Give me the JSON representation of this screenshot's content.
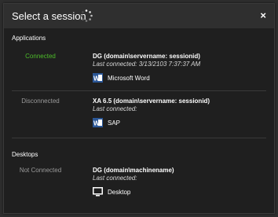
{
  "dialog": {
    "title": "Select a session",
    "close_label": "×"
  },
  "applications": {
    "header": "Applications",
    "sessions": [
      {
        "status": "Connected",
        "name": "DG (domain\\servername: sessionid)",
        "last_connected": "Last connected: 3/13/2103 7:37:37 AM",
        "app_label": "Microsoft Word",
        "app_icon": "word-icon"
      },
      {
        "status": "Disconnected",
        "name": "XA 6.5 (domain\\servername: sessionid)",
        "last_connected": "Last connected:",
        "app_label": "SAP",
        "app_icon": "word-icon"
      }
    ]
  },
  "desktops": {
    "header": "Desktops",
    "sessions": [
      {
        "status": "Not Connected",
        "name": "DG (domain\\machinename)",
        "last_connected": "Last connected:",
        "app_label": "Desktop",
        "app_icon": "monitor-icon"
      }
    ]
  },
  "colors": {
    "connected": "#4dbd2a",
    "status_inactive": "#9a9a9a",
    "word_blue": "#2b5797"
  }
}
